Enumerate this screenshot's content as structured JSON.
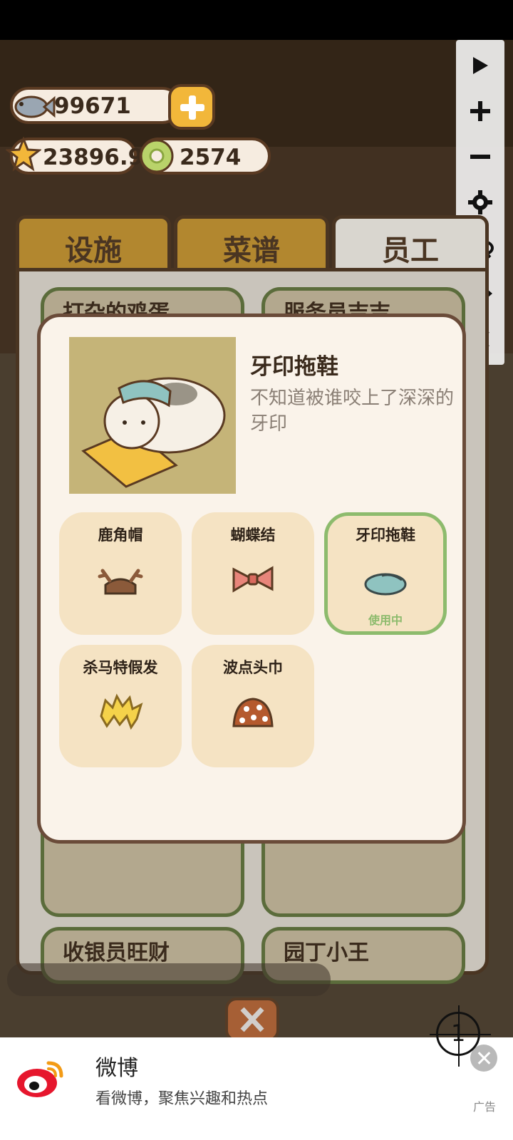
{
  "currency": {
    "fish": "99671",
    "stars": "23896.9",
    "coins": "2574"
  },
  "tabs": [
    {
      "label": "设施",
      "active": false
    },
    {
      "label": "菜谱",
      "active": false
    },
    {
      "label": "员工",
      "active": true
    }
  ],
  "staff_cards": [
    {
      "name": "打杂的鸡蛋"
    },
    {
      "name": "服务员吉吉"
    },
    {
      "name": "收银员旺财"
    },
    {
      "name": "园丁小王"
    }
  ],
  "dialog": {
    "title": "牙印拖鞋",
    "description": "不知道被谁咬上了深深的牙印",
    "accessories": [
      {
        "name": "鹿角帽",
        "icon": "antler-hat-icon",
        "selected": false
      },
      {
        "name": "蝴蝶结",
        "icon": "bow-icon",
        "selected": false
      },
      {
        "name": "牙印拖鞋",
        "icon": "slipper-icon",
        "selected": true,
        "status": "使用中"
      },
      {
        "name": "杀马特假发",
        "icon": "wig-icon",
        "selected": false
      },
      {
        "name": "波点头巾",
        "icon": "polka-bandana-icon",
        "selected": false
      }
    ]
  },
  "toolbar": [
    "play-icon",
    "zoom-in-icon",
    "zoom-out-icon",
    "settings-icon",
    "hide-icon",
    "move-icon",
    "close-icon"
  ],
  "ad": {
    "app_name": "微博",
    "slogan": "看微博，聚焦兴趣和热点",
    "tag": "广告"
  },
  "crosshair_label": "1",
  "colors": {
    "panel_border": "#4a3522",
    "selected_border": "#8dbb6d",
    "accessory_bg": "#f5e3c3",
    "dialog_bg": "#faf3ea"
  }
}
